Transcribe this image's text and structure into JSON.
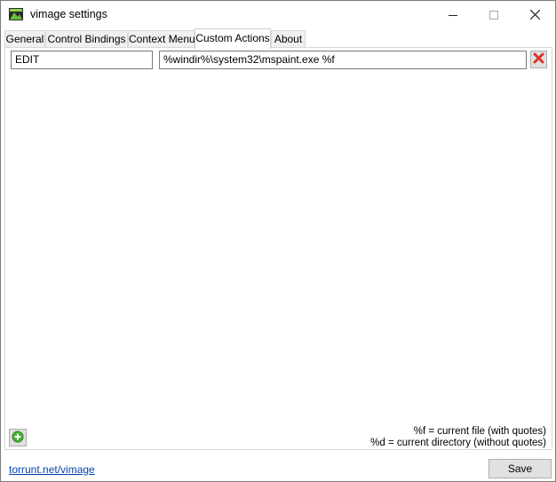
{
  "window": {
    "title": "vimage settings",
    "app_icon": "vimage-icon",
    "controls": [
      "minimize-icon",
      "maximize-icon",
      "close-icon"
    ]
  },
  "tabs": [
    {
      "label": "General",
      "active": false
    },
    {
      "label": "Control Bindings",
      "active": false
    },
    {
      "label": "Context Menu",
      "active": false
    },
    {
      "label": "Custom Actions",
      "active": true
    },
    {
      "label": "About",
      "active": false
    }
  ],
  "actions": [
    {
      "name": "EDIT",
      "command": "%windir%\\system32\\mspaint.exe %f"
    }
  ],
  "icons": {
    "remove": "remove-x-icon",
    "add": "add-plus-icon"
  },
  "help": {
    "line1": "%f = current file (with quotes)",
    "line2": "%d = current directory (without quotes)"
  },
  "footer": {
    "link": "torrunt.net/vimage",
    "save_label": "Save"
  },
  "colors": {
    "link": "#0645ad",
    "remove_icon": "#d9342b",
    "add_icon": "#4caf3a"
  }
}
